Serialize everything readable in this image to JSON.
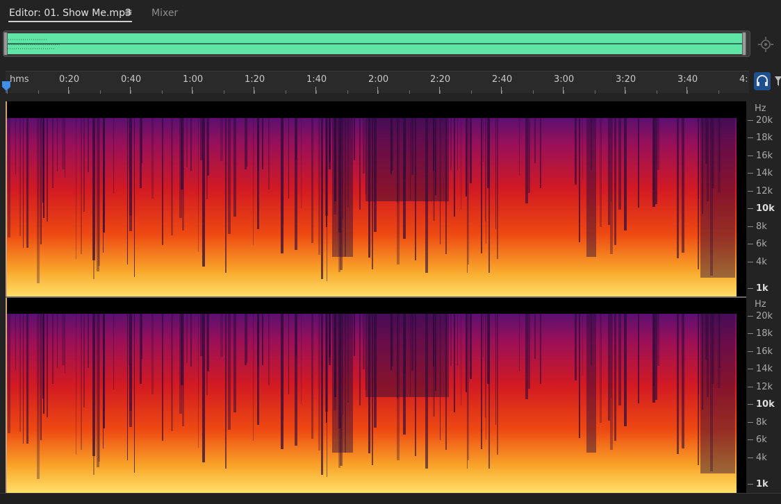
{
  "tabs": {
    "editor_label": "Editor: 01. Show Me.mp3",
    "menu_glyph": "≡",
    "mixer_label": "Mixer"
  },
  "ruler": {
    "unit_label": "hms",
    "labels": [
      "0:20",
      "0:40",
      "1:00",
      "1:20",
      "1:40",
      "2:00",
      "2:20",
      "2:40",
      "3:00",
      "3:20",
      "3:40",
      "4:"
    ]
  },
  "frequency_scale": {
    "unit": "Hz",
    "labels": [
      "20k",
      "18k",
      "16k",
      "14k",
      "12k",
      "10k",
      "8k",
      "6k",
      "4k",
      "1k"
    ],
    "bold_labels": [
      "10k",
      "1k"
    ]
  },
  "colors": {
    "waveform": "#60e5a6",
    "accent_button": "#1e4f8f",
    "playhead": "#3f8fe8"
  },
  "icons": {
    "tab_menu": "hamburger-menu-icon",
    "zoom": "zoom-target-icon",
    "headphones": "headphones-icon",
    "filter": "filter-icon",
    "playhead": "playhead-marker-icon"
  }
}
